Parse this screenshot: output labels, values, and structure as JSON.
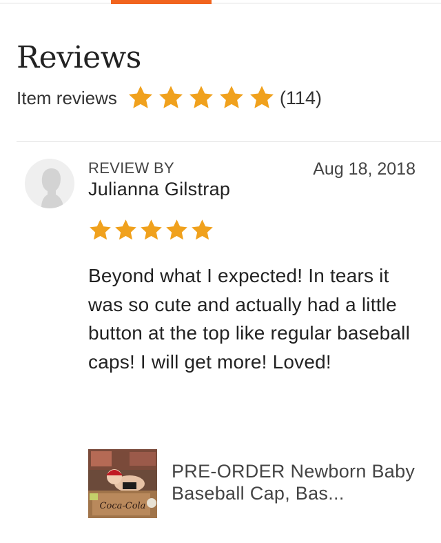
{
  "reviews": {
    "heading": "Reviews",
    "summary": {
      "label": "Item reviews",
      "rating": 5,
      "count": "(114)"
    }
  },
  "review": {
    "by_label": "REVIEW BY",
    "reviewer_name": "Julianna Gilstrap",
    "date": "Aug 18, 2018",
    "rating": 5,
    "text": "Beyond what I expected! In tears it was so cute and actually had a little button at the top like regular baseball caps! I will get more! Loved!",
    "avatar_icon": "user-silhouette-icon"
  },
  "product": {
    "title": "PRE-ORDER Newborn Baby Baseball Cap, Bas...",
    "thumb_sign_text": "Coca-Cola"
  },
  "colors": {
    "accent": "#f1641e",
    "star": "#f0a11d"
  }
}
